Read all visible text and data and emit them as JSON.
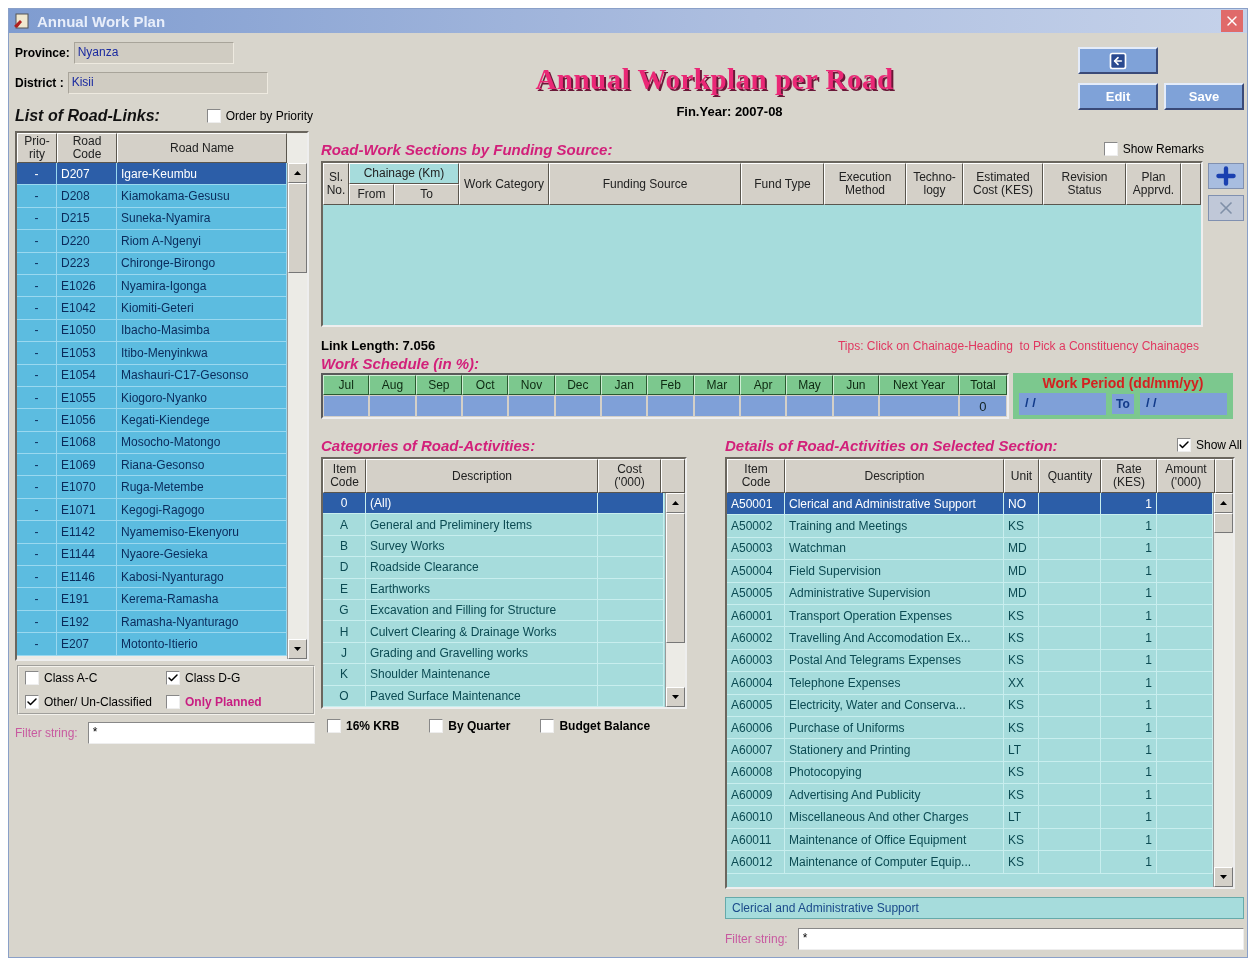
{
  "window": {
    "title": "Annual Work Plan"
  },
  "province": {
    "label": "Province:",
    "value": "Nyanza"
  },
  "district": {
    "label": "District :",
    "value": "Kisii"
  },
  "road_links": {
    "title": "List of Road-Links:",
    "order_by_priority": {
      "label": "Order by Priority",
      "checked": false
    },
    "columns": [
      "Prio- rity",
      "Road Code",
      "Road Name"
    ],
    "rows": [
      {
        "priority": "-",
        "code": "D207",
        "name": "Igare-Keumbu",
        "selected": true
      },
      {
        "priority": "-",
        "code": "D208",
        "name": "Kiamokama-Gesusu",
        "selected": false
      },
      {
        "priority": "-",
        "code": "D215",
        "name": "Suneka-Nyamira",
        "selected": false
      },
      {
        "priority": "-",
        "code": "D220",
        "name": "Riom A-Ngenyi",
        "selected": false
      },
      {
        "priority": "-",
        "code": "D223",
        "name": "Chironge-Birongo",
        "selected": false
      },
      {
        "priority": "-",
        "code": "E1026",
        "name": "Nyamira-Igonga",
        "selected": false
      },
      {
        "priority": "-",
        "code": "E1042",
        "name": "Kiomiti-Geteri",
        "selected": false
      },
      {
        "priority": "-",
        "code": "E1050",
        "name": "Ibacho-Masimba",
        "selected": false
      },
      {
        "priority": "-",
        "code": "E1053",
        "name": "Itibo-Menyinkwa",
        "selected": false
      },
      {
        "priority": "-",
        "code": "E1054",
        "name": "Mashauri-C17-Gesonso",
        "selected": false
      },
      {
        "priority": "-",
        "code": "E1055",
        "name": "Kiogoro-Nyanko",
        "selected": false
      },
      {
        "priority": "-",
        "code": "E1056",
        "name": "Kegati-Kiendege",
        "selected": false
      },
      {
        "priority": "-",
        "code": "E1068",
        "name": "Mosocho-Matongo",
        "selected": false
      },
      {
        "priority": "-",
        "code": "E1069",
        "name": "Riana-Gesonso",
        "selected": false
      },
      {
        "priority": "-",
        "code": "E1070",
        "name": "Ruga-Metembe",
        "selected": false
      },
      {
        "priority": "-",
        "code": "E1071",
        "name": "Kegogi-Ragogo",
        "selected": false
      },
      {
        "priority": "-",
        "code": "E1142",
        "name": "Nyamemiso-Ekenyoru",
        "selected": false
      },
      {
        "priority": "-",
        "code": "E1144",
        "name": "Nyaore-Gesieka",
        "selected": false
      },
      {
        "priority": "-",
        "code": "E1146",
        "name": "Kabosi-Nyanturago",
        "selected": false
      },
      {
        "priority": "-",
        "code": "E191",
        "name": "Kerema-Ramasha",
        "selected": false
      },
      {
        "priority": "-",
        "code": "E192",
        "name": "Ramasha-Nyanturago",
        "selected": false
      },
      {
        "priority": "-",
        "code": "E207",
        "name": "Motonto-Itierio",
        "selected": false
      }
    ],
    "filters": [
      {
        "label": "Class A-C",
        "checked": false,
        "kind": "plain"
      },
      {
        "label": "Class D-G",
        "checked": true,
        "kind": "plain"
      },
      {
        "label": "Other/ Un-Classified",
        "checked": true,
        "kind": "plain"
      },
      {
        "label": "Only Planned",
        "checked": false,
        "kind": "highlight"
      }
    ],
    "filter_string": {
      "label": "Filter string:",
      "value": "*"
    }
  },
  "heading": {
    "title": "Annual Workplan per Road",
    "fin_year": "Fin.Year: 2007-08"
  },
  "buttons": [
    {
      "kind": "back"
    },
    {
      "kind": "text",
      "label": "Edit"
    },
    {
      "kind": "text",
      "label": "Save"
    }
  ],
  "sections": {
    "title": "Road-Work Sections by Funding Source:",
    "show_remarks": {
      "label": "Show Remarks",
      "checked": false
    },
    "columns": [
      {
        "kind": "single",
        "label": "Sl. No."
      },
      {
        "kind": "group",
        "label": "Chainage (Km)",
        "sub": [
          "From",
          "To"
        ]
      },
      {
        "kind": "single",
        "label": "Work Category"
      },
      {
        "kind": "single",
        "label": "Funding Source"
      },
      {
        "kind": "single",
        "label": "Fund Type"
      },
      {
        "kind": "single",
        "label": "Execution Method"
      },
      {
        "kind": "single",
        "label": "Techno- logy"
      },
      {
        "kind": "single",
        "label": "Estimated Cost (KES)"
      },
      {
        "kind": "single",
        "label": "Revision Status"
      },
      {
        "kind": "single",
        "label": "Plan Apprvd."
      }
    ],
    "tools": [
      {
        "kind": "add",
        "disabled": false
      },
      {
        "kind": "delete",
        "disabled": true
      }
    ]
  },
  "link_length": "Link Length: 7.056",
  "tips": "Tips: Click on Chainage-Heading  to Pick a Constituency Chainages",
  "schedule": {
    "title": "Work Schedule (in %):",
    "months": [
      "Jul",
      "Aug",
      "Sep",
      "Oct",
      "Nov",
      "Dec",
      "Jan",
      "Feb",
      "Mar",
      "Apr",
      "May",
      "Jun",
      "Next Year",
      "Total"
    ],
    "total": "0",
    "work_period": {
      "title": "Work Period (dd/mm/yy)",
      "from": "/ /",
      "to_label": "To",
      "to": "/ /"
    }
  },
  "categories": {
    "title": "Categories of Road-Activities:",
    "columns": [
      "Item Code",
      "Description",
      "Cost ('000)"
    ],
    "rows": [
      {
        "code": "0",
        "description": "(All)",
        "selected": true
      },
      {
        "code": "A",
        "description": "General and Preliminery Items",
        "selected": false
      },
      {
        "code": "B",
        "description": "Survey Works",
        "selected": false
      },
      {
        "code": "D",
        "description": "Roadside Clearance",
        "selected": false
      },
      {
        "code": "E",
        "description": "Earthworks",
        "selected": false
      },
      {
        "code": "G",
        "description": "Excavation and Filling for Structure",
        "selected": false
      },
      {
        "code": "H",
        "description": "Culvert Clearing & Drainage Works",
        "selected": false
      },
      {
        "code": "J",
        "description": "Grading and Gravelling works",
        "selected": false
      },
      {
        "code": "K",
        "description": "Shoulder Maintenance",
        "selected": false
      },
      {
        "code": "O",
        "description": "Paved Surface Maintenance",
        "selected": false
      }
    ],
    "options": [
      {
        "label": "16% KRB",
        "checked": false
      },
      {
        "label": "By Quarter",
        "checked": false
      },
      {
        "label": "Budget Balance",
        "checked": false
      }
    ]
  },
  "details": {
    "title": "Details of Road-Activities on Selected Section:",
    "show_all": {
      "label": "Show All",
      "checked": true
    },
    "columns": [
      "Item Code",
      "Description",
      "Unit",
      "Quantity",
      "Rate (KES)",
      "Amount ('000)"
    ],
    "rows": [
      {
        "code": "A50001",
        "description": "Clerical and Administrative Support",
        "unit": "NO",
        "rate": "1",
        "selected": true
      },
      {
        "code": "A50002",
        "description": "Training and Meetings",
        "unit": "KS",
        "rate": "1",
        "selected": false
      },
      {
        "code": "A50003",
        "description": "Watchman",
        "unit": "MD",
        "rate": "1",
        "selected": false
      },
      {
        "code": "A50004",
        "description": "Field Supervision",
        "unit": "MD",
        "rate": "1",
        "selected": false
      },
      {
        "code": "A50005",
        "description": "Administrative Supervision",
        "unit": "MD",
        "rate": "1",
        "selected": false
      },
      {
        "code": "A60001",
        "description": "Transport Operation Expenses",
        "unit": "KS",
        "rate": "1",
        "selected": false
      },
      {
        "code": "A60002",
        "description": "Travelling And Accomodation Ex...",
        "unit": "KS",
        "rate": "1",
        "selected": false
      },
      {
        "code": "A60003",
        "description": "Postal And Telegrams Expenses",
        "unit": "KS",
        "rate": "1",
        "selected": false
      },
      {
        "code": "A60004",
        "description": "Telephone Expenses",
        "unit": "XX",
        "rate": "1",
        "selected": false
      },
      {
        "code": "A60005",
        "description": "Electricity, Water and Conserva...",
        "unit": "KS",
        "rate": "1",
        "selected": false
      },
      {
        "code": "A60006",
        "description": "Purchase of Uniforms",
        "unit": "KS",
        "rate": "1",
        "selected": false
      },
      {
        "code": "A60007",
        "description": "Stationery and Printing",
        "unit": "LT",
        "rate": "1",
        "selected": false
      },
      {
        "code": "A60008",
        "description": "Photocopying",
        "unit": "KS",
        "rate": "1",
        "selected": false
      },
      {
        "code": "A60009",
        "description": "Advertising And Publicity",
        "unit": "KS",
        "rate": "1",
        "selected": false
      },
      {
        "code": "A60010",
        "description": "Miscellaneous And other Charges",
        "unit": "LT",
        "rate": "1",
        "selected": false
      },
      {
        "code": "A60011",
        "description": "Maintenance of Office Equipment",
        "unit": "KS",
        "rate": "1",
        "selected": false
      },
      {
        "code": "A60012",
        "description": "Maintenance of Computer Equip...",
        "unit": "KS",
        "rate": "1",
        "selected": false
      }
    ],
    "selected_description": "Clerical and Administrative Support",
    "filter_string": {
      "label": "Filter string:",
      "value": "*"
    }
  }
}
